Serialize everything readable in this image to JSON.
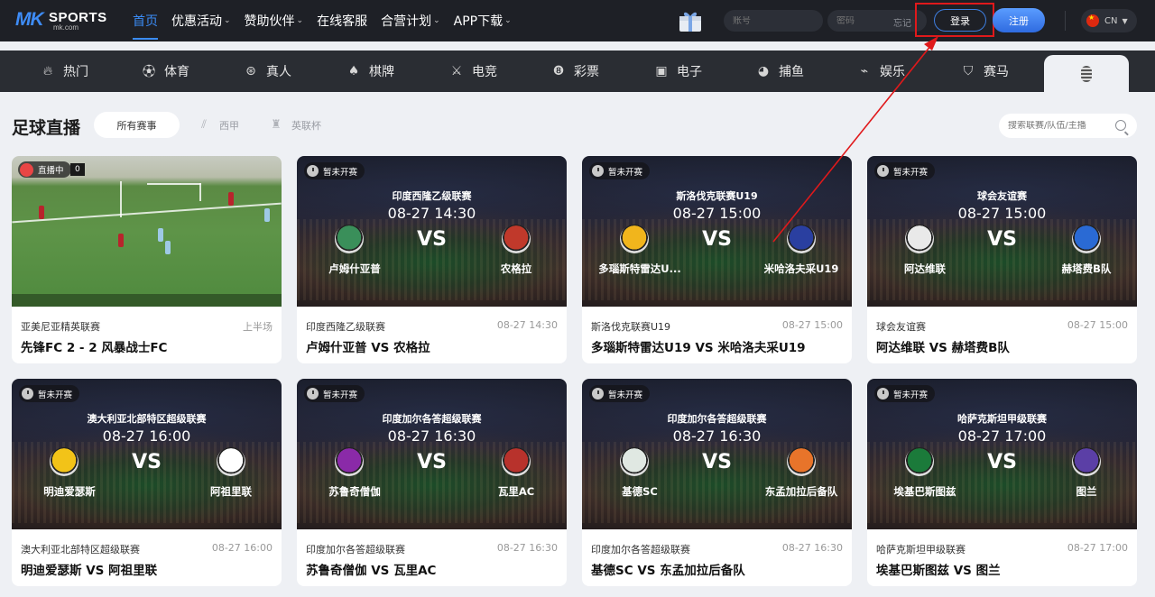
{
  "brand": {
    "logo_mk": "MK",
    "logo_sports": "SPORTS",
    "logo_domain": "mk.com"
  },
  "topnav": [
    {
      "label": "首页",
      "active": true,
      "dropdown": false
    },
    {
      "label": "优惠活动",
      "dropdown": true
    },
    {
      "label": "赞助伙伴",
      "dropdown": true
    },
    {
      "label": "在线客服",
      "dropdown": false
    },
    {
      "label": "合营计划",
      "dropdown": true
    },
    {
      "label": "APP下载",
      "dropdown": true
    }
  ],
  "auth": {
    "account_placeholder": "账号",
    "password_placeholder": "密码",
    "forgot_label": "忘记",
    "login_label": "登录",
    "register_label": "注册",
    "lang_label": "CN"
  },
  "categories": [
    {
      "label": "热门",
      "icon": "flame-icon"
    },
    {
      "label": "体育",
      "icon": "soccer-ball-icon"
    },
    {
      "label": "真人",
      "icon": "chip-icon"
    },
    {
      "label": "棋牌",
      "icon": "spade-icon"
    },
    {
      "label": "电竞",
      "icon": "swords-icon"
    },
    {
      "label": "彩票",
      "icon": "lottery-ball-icon"
    },
    {
      "label": "电子",
      "icon": "slot-machine-icon"
    },
    {
      "label": "捕鱼",
      "icon": "fish-icon"
    },
    {
      "label": "娱乐",
      "icon": "shoe-icon"
    },
    {
      "label": "赛马",
      "icon": "horse-shield-icon"
    }
  ],
  "section": {
    "title": "足球直播",
    "filters": [
      "所有赛事",
      "西甲",
      "英联杯"
    ],
    "search_placeholder": "搜索联赛/队伍/主播"
  },
  "live_card": {
    "badge": "直播中",
    "score_overlay": "0",
    "league": "亚美尼亚精英联赛",
    "status": "上半场",
    "match": "先锋FC 2 - 2 风暴战士FC"
  },
  "cards": [
    {
      "badge": "暂未开赛",
      "league_top": "印度西隆乙级联赛",
      "time_top": "08-27 14:30",
      "vs": "VS",
      "home": "卢姆什亚普",
      "away": "农格拉",
      "league": "印度西隆乙级联赛",
      "time": "08-27 14:30",
      "match": "卢姆什亚普 VS 农格拉",
      "home_color": "#3a8f5a",
      "away_color": "#c0392b"
    },
    {
      "badge": "暂未开赛",
      "league_top": "斯洛伐克联赛U19",
      "time_top": "08-27 15:00",
      "vs": "VS",
      "home": "多瑙斯特雷达U...",
      "away": "米哈洛夫采U19",
      "league": "斯洛伐克联赛U19",
      "time": "08-27 15:00",
      "match": "多瑙斯特雷达U19 VS 米哈洛夫采U19",
      "home_color": "#f1b51c",
      "away_color": "#2a3fa0"
    },
    {
      "badge": "暂未开赛",
      "league_top": "球会友谊赛",
      "time_top": "08-27 15:00",
      "vs": "VS",
      "home": "阿达维联",
      "away": "赫塔费B队",
      "league": "球会友谊赛",
      "time": "08-27 15:00",
      "match": "阿达维联 VS 赫塔费B队",
      "home_color": "#e9e9e9",
      "away_color": "#2a6ad4"
    },
    {
      "badge": "暂未开赛",
      "league_top": "澳大利亚北部特区超级联赛",
      "time_top": "08-27 16:00",
      "vs": "VS",
      "home": "明迪爱瑟斯",
      "away": "阿祖里联",
      "league": "澳大利亚北部特区超级联赛",
      "time": "08-27 16:00",
      "match": "明迪爱瑟斯 VS 阿祖里联",
      "home_color": "#f2c318",
      "away_color": "#ffffff"
    },
    {
      "badge": "暂未开赛",
      "league_top": "印度加尔各答超级联赛",
      "time_top": "08-27 16:30",
      "vs": "VS",
      "home": "苏鲁奇僧伽",
      "away": "瓦里AC",
      "league": "印度加尔各答超级联赛",
      "time": "08-27 16:30",
      "match": "苏鲁奇僧伽 VS 瓦里AC",
      "home_color": "#8a2aa8",
      "away_color": "#b8322c"
    },
    {
      "badge": "暂未开赛",
      "league_top": "印度加尔各答超级联赛",
      "time_top": "08-27 16:30",
      "vs": "VS",
      "home": "基德SC",
      "away": "东孟加拉后备队",
      "league": "印度加尔各答超级联赛",
      "time": "08-27 16:30",
      "match": "基德SC VS 东孟加拉后备队",
      "home_color": "#e0e8e2",
      "away_color": "#e8742a"
    },
    {
      "badge": "暂未开赛",
      "league_top": "哈萨克斯坦甲级联赛",
      "time_top": "08-27 17:00",
      "vs": "VS",
      "home": "埃基巴斯图兹",
      "away": "图兰",
      "league": "哈萨克斯坦甲级联赛",
      "time": "08-27 17:00",
      "match": "埃基巴斯图兹 VS 图兰",
      "home_color": "#1b7a3a",
      "away_color": "#5b3fa6"
    }
  ]
}
